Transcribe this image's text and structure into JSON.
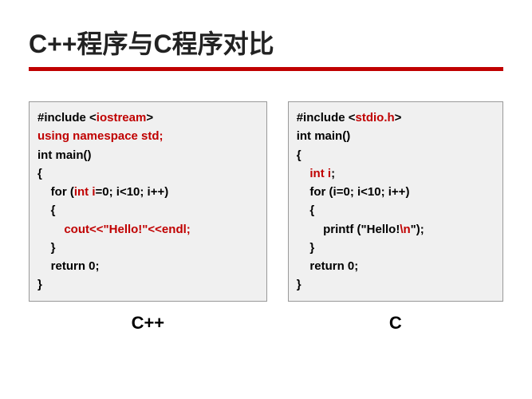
{
  "title": "C++程序与C程序对比",
  "left": {
    "label": "C++",
    "code": [
      {
        "indent": 0,
        "parts": [
          {
            "t": "#include <",
            "c": "t-black"
          },
          {
            "t": "iostream",
            "c": "t-red"
          },
          {
            "t": ">",
            "c": "t-black"
          }
        ]
      },
      {
        "indent": 0,
        "parts": [
          {
            "t": "using namespace std;",
            "c": "t-red"
          }
        ]
      },
      {
        "indent": 0,
        "parts": [
          {
            "t": "int main()",
            "c": "t-black"
          }
        ]
      },
      {
        "indent": 0,
        "parts": [
          {
            "t": "{",
            "c": "t-black"
          }
        ]
      },
      {
        "indent": 1,
        "parts": [
          {
            "t": "for (",
            "c": "t-black"
          },
          {
            "t": "int i",
            "c": "t-red"
          },
          {
            "t": "=0; i<10; i++)",
            "c": "t-black"
          }
        ]
      },
      {
        "indent": 1,
        "parts": [
          {
            "t": "{",
            "c": "t-black"
          }
        ]
      },
      {
        "indent": 2,
        "parts": [
          {
            "t": "cout<<\"Hello!\"<<endl;",
            "c": "t-red"
          }
        ]
      },
      {
        "indent": 1,
        "parts": [
          {
            "t": "}",
            "c": "t-black"
          }
        ]
      },
      {
        "indent": 1,
        "parts": [
          {
            "t": "return 0;",
            "c": "t-black"
          }
        ]
      },
      {
        "indent": 0,
        "parts": [
          {
            "t": "}",
            "c": "t-black"
          }
        ]
      }
    ]
  },
  "right": {
    "label": "C",
    "code": [
      {
        "indent": 0,
        "parts": [
          {
            "t": "#include <",
            "c": "t-black"
          },
          {
            "t": "stdio.h",
            "c": "t-red"
          },
          {
            "t": ">",
            "c": "t-black"
          }
        ]
      },
      {
        "indent": 0,
        "parts": [
          {
            "t": "int main()",
            "c": "t-black"
          }
        ]
      },
      {
        "indent": 0,
        "parts": [
          {
            "t": "{",
            "c": "t-black"
          }
        ]
      },
      {
        "indent": 1,
        "parts": [
          {
            "t": "int i",
            "c": "t-red"
          },
          {
            "t": ";",
            "c": "t-black"
          }
        ]
      },
      {
        "indent": 1,
        "parts": [
          {
            "t": "for (i=0; i<10; i++)",
            "c": "t-black"
          }
        ]
      },
      {
        "indent": 1,
        "parts": [
          {
            "t": "{",
            "c": "t-black"
          }
        ]
      },
      {
        "indent": 2,
        "parts": [
          {
            "t": "printf (\"Hello!",
            "c": "t-black"
          },
          {
            "t": "\\n",
            "c": "t-red"
          },
          {
            "t": "\");",
            "c": "t-black"
          }
        ]
      },
      {
        "indent": 1,
        "parts": [
          {
            "t": "}",
            "c": "t-black"
          }
        ]
      },
      {
        "indent": 1,
        "parts": [
          {
            "t": "return 0;",
            "c": "t-black"
          }
        ]
      },
      {
        "indent": 0,
        "parts": [
          {
            "t": "}",
            "c": "t-black"
          }
        ]
      }
    ]
  }
}
